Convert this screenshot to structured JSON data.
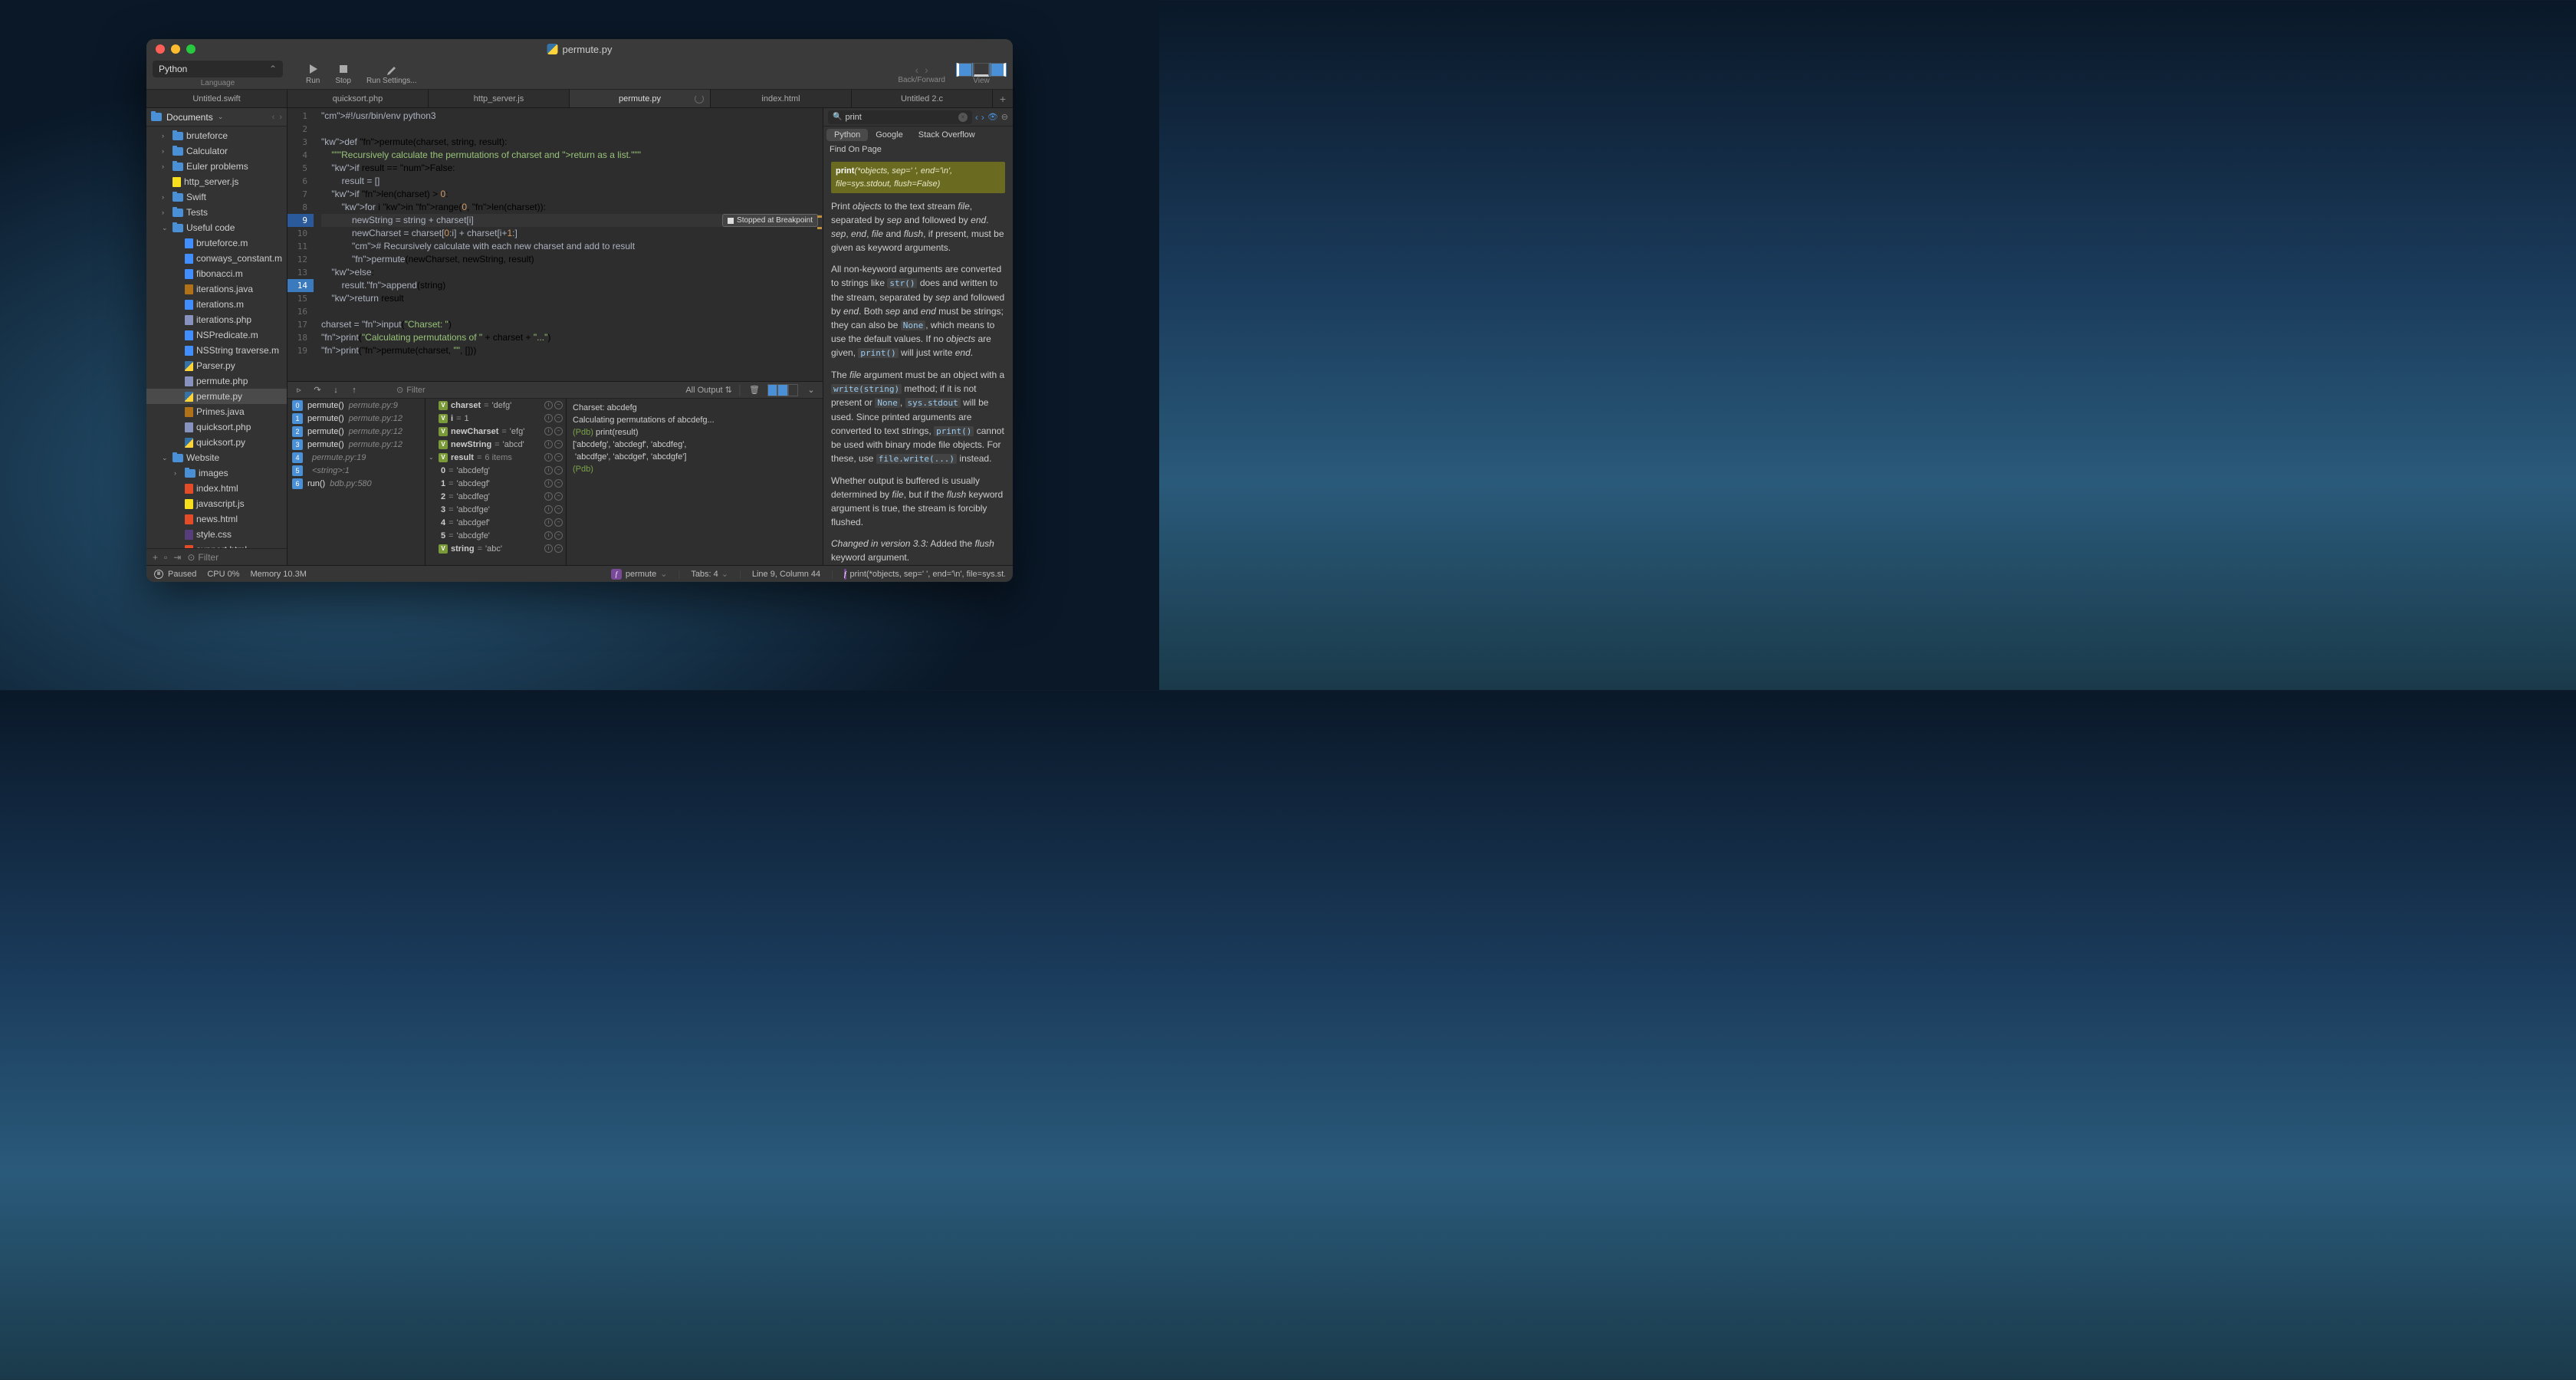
{
  "window": {
    "title": "permute.py"
  },
  "toolbar": {
    "language": "Python",
    "language_label": "Language",
    "run": "Run",
    "stop": "Stop",
    "run_settings": "Run Settings...",
    "back_forward": "Back/Forward",
    "view": "View"
  },
  "tabs": [
    {
      "label": "Untitled.swift",
      "active": false
    },
    {
      "label": "quicksort.php",
      "active": false
    },
    {
      "label": "http_server.js",
      "active": false
    },
    {
      "label": "permute.py",
      "active": true,
      "loading": true
    },
    {
      "label": "index.html",
      "active": false
    },
    {
      "label": "Untitled 2.c",
      "active": false
    }
  ],
  "sidebar": {
    "root": "Documents",
    "filter_placeholder": "Filter",
    "tree": [
      {
        "type": "folder",
        "name": "bruteforce",
        "level": 1,
        "expanded": false
      },
      {
        "type": "folder",
        "name": "Calculator",
        "level": 1,
        "expanded": false
      },
      {
        "type": "folder",
        "name": "Euler problems",
        "level": 1,
        "expanded": false
      },
      {
        "type": "file",
        "name": "http_server.js",
        "level": 1,
        "ext": "js"
      },
      {
        "type": "folder",
        "name": "Swift",
        "level": 1,
        "expanded": false
      },
      {
        "type": "folder",
        "name": "Tests",
        "level": 1,
        "expanded": false
      },
      {
        "type": "folder",
        "name": "Useful code",
        "level": 1,
        "expanded": true
      },
      {
        "type": "file",
        "name": "bruteforce.m",
        "level": 2,
        "ext": "m"
      },
      {
        "type": "file",
        "name": "conways_constant.m",
        "level": 2,
        "ext": "m"
      },
      {
        "type": "file",
        "name": "fibonacci.m",
        "level": 2,
        "ext": "m"
      },
      {
        "type": "file",
        "name": "iterations.java",
        "level": 2,
        "ext": "java"
      },
      {
        "type": "file",
        "name": "iterations.m",
        "level": 2,
        "ext": "m"
      },
      {
        "type": "file",
        "name": "iterations.php",
        "level": 2,
        "ext": "php"
      },
      {
        "type": "file",
        "name": "NSPredicate.m",
        "level": 2,
        "ext": "m"
      },
      {
        "type": "file",
        "name": "NSString traverse.m",
        "level": 2,
        "ext": "m"
      },
      {
        "type": "file",
        "name": "Parser.py",
        "level": 2,
        "ext": "py"
      },
      {
        "type": "file",
        "name": "permute.php",
        "level": 2,
        "ext": "php"
      },
      {
        "type": "file",
        "name": "permute.py",
        "level": 2,
        "ext": "py",
        "selected": true
      },
      {
        "type": "file",
        "name": "Primes.java",
        "level": 2,
        "ext": "java"
      },
      {
        "type": "file",
        "name": "quicksort.php",
        "level": 2,
        "ext": "php"
      },
      {
        "type": "file",
        "name": "quicksort.py",
        "level": 2,
        "ext": "py"
      },
      {
        "type": "folder",
        "name": "Website",
        "level": 1,
        "expanded": true
      },
      {
        "type": "folder",
        "name": "images",
        "level": 2,
        "expanded": false
      },
      {
        "type": "file",
        "name": "index.html",
        "level": 2,
        "ext": "html"
      },
      {
        "type": "file",
        "name": "javascript.js",
        "level": 2,
        "ext": "js"
      },
      {
        "type": "file",
        "name": "news.html",
        "level": 2,
        "ext": "html"
      },
      {
        "type": "file",
        "name": "style.css",
        "level": 2,
        "ext": "css"
      },
      {
        "type": "file",
        "name": "support.html",
        "level": 2,
        "ext": "html"
      }
    ]
  },
  "editor": {
    "stopped_label": "Stopped at Breakpoint",
    "breakpoint_line": 9,
    "current_line": 14,
    "lines": [
      "#!/usr/bin/env python3",
      "",
      "def permute(charset, string, result):",
      "    \"\"\"Recursively calculate the permutations of charset and return as a list.\"\"\"",
      "    if result == False:",
      "        result = []",
      "    if len(charset) > 0:",
      "        for i in range(0, len(charset)):",
      "            newString = string + charset[i]",
      "            newCharset = charset[0:i] + charset[i+1:]",
      "            # Recursively calculate with each new charset and add to result",
      "            permute(newCharset, newString, result)",
      "    else:",
      "        result.append(string)",
      "    return result",
      "",
      "charset = input(\"Charset: \")",
      "print(\"Calculating permutations of \" + charset + \"...\")",
      "print(permute(charset, \"\", []))"
    ]
  },
  "debug": {
    "filter_placeholder": "Filter",
    "output_select": "All Output",
    "stack": [
      {
        "num": "0",
        "fn": "permute()",
        "loc": "permute.py:9"
      },
      {
        "num": "1",
        "fn": "permute()",
        "loc": "permute.py:12"
      },
      {
        "num": "2",
        "fn": "permute()",
        "loc": "permute.py:12"
      },
      {
        "num": "3",
        "fn": "permute()",
        "loc": "permute.py:12"
      },
      {
        "num": "4",
        "fn": "",
        "loc": "permute.py:19"
      },
      {
        "num": "5",
        "fn": "",
        "loc": "<string>:1"
      },
      {
        "num": "6",
        "fn": "run()",
        "loc": "bdb.py:580"
      }
    ],
    "vars": [
      {
        "name": "charset",
        "val": "'defg'",
        "badge": "V"
      },
      {
        "name": "i",
        "val": "1",
        "badge": "V"
      },
      {
        "name": "newCharset",
        "val": "'efg'",
        "badge": "V"
      },
      {
        "name": "newString",
        "val": "'abcd'",
        "badge": "V"
      },
      {
        "name": "result",
        "val": "6 items",
        "badge": "V",
        "expanded": true,
        "children": [
          {
            "name": "0",
            "val": "'abcdefg'"
          },
          {
            "name": "1",
            "val": "'abcdegf'"
          },
          {
            "name": "2",
            "val": "'abcdfeg'"
          },
          {
            "name": "3",
            "val": "'abcdfge'"
          },
          {
            "name": "4",
            "val": "'abcdgef'"
          },
          {
            "name": "5",
            "val": "'abcdgfe'"
          }
        ]
      },
      {
        "name": "string",
        "val": "'abc'",
        "badge": "V"
      }
    ],
    "console": [
      "Charset: abcdefg",
      "Calculating permutations of abcdefg...",
      "(Pdb) print(result)",
      "['abcdefg', 'abcdegf', 'abcdfeg',",
      " 'abcdfge', 'abcdgef', 'abcdgfe']",
      "(Pdb) "
    ]
  },
  "docs": {
    "search": "print",
    "tabs": [
      "Python",
      "Google",
      "Stack Overflow"
    ],
    "find_on_page": "Find On Page",
    "signature_fn": "print",
    "signature_args": "(*objects, sep=' ', end='\\n', file=sys.stdout, flush=False)",
    "paragraphs": {
      "p1_a": "Print ",
      "p1_b": " to the text stream ",
      "p1_c": ", separated by ",
      "p1_d": " and followed by ",
      "p1_e": ". ",
      "p1_f": ", ",
      "p1_g": ", ",
      "p1_h": " and ",
      "p1_i": ", if present, must be given as keyword arguments.",
      "p2_a": "All non-keyword arguments are converted to strings like ",
      "p2_b": " does and written to the stream, separated by ",
      "p2_c": " and followed by ",
      "p2_d": ". Both ",
      "p2_e": " and ",
      "p2_f": " must be strings; they can also be ",
      "p2_g": ", which means to use the default values. If no ",
      "p2_h": " are given, ",
      "p2_i": " will just write ",
      "p2_j": ".",
      "p3_a": "The ",
      "p3_b": " argument must be an object with a ",
      "p3_c": " method; if it is not present or ",
      "p3_d": ", ",
      "p3_e": " will be used. Since printed arguments are converted to text strings, ",
      "p3_f": " cannot be used with binary mode file objects. For these, use ",
      "p3_g": " instead.",
      "p4_a": "Whether output is buffered is usually determined by ",
      "p4_b": ", but if the ",
      "p4_c": " keyword argument is true, the stream is forcibly flushed.",
      "p5_a": "Changed in version 3.3:",
      "p5_b": " Added the ",
      "p5_c": " keyword argument."
    },
    "terms": {
      "objects": "objects",
      "file": "file",
      "sep": "sep",
      "end": "end",
      "flush": "flush",
      "None": "None",
      "str": "str()",
      "print": "print()",
      "write_string": "write(string)",
      "sys_stdout": "sys.stdout",
      "file_write": "file.write(...)"
    }
  },
  "status": {
    "paused": "Paused",
    "cpu": "CPU 0%",
    "memory": "Memory 10.3M",
    "symbol": "permute",
    "tabs": "Tabs: 4",
    "position": "Line 9, Column 44",
    "doc_sig": "print(*objects, sep=' ', end='\\n', file=sys.st..."
  }
}
